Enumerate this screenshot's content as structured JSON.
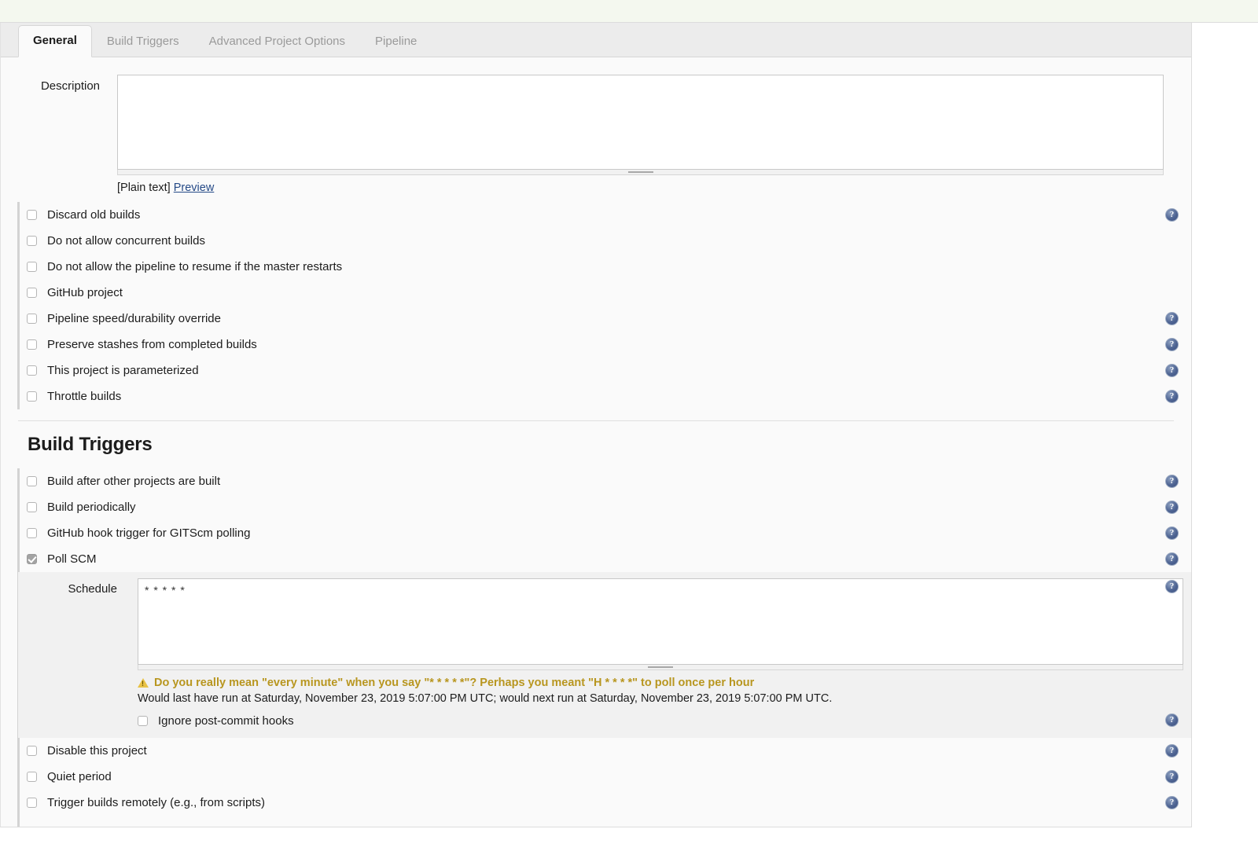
{
  "tabs": [
    {
      "label": "General",
      "active": true
    },
    {
      "label": "Build Triggers",
      "active": false
    },
    {
      "label": "Advanced Project Options",
      "active": false
    },
    {
      "label": "Pipeline",
      "active": false
    }
  ],
  "description": {
    "label": "Description",
    "value": "",
    "markup_note": "[Plain text]",
    "preview_link": "Preview"
  },
  "general_options": [
    {
      "label": "Discard old builds",
      "checked": false,
      "help": true
    },
    {
      "label": "Do not allow concurrent builds",
      "checked": false,
      "help": false
    },
    {
      "label": "Do not allow the pipeline to resume if the master restarts",
      "checked": false,
      "help": false
    },
    {
      "label": "GitHub project",
      "checked": false,
      "help": false
    },
    {
      "label": "Pipeline speed/durability override",
      "checked": false,
      "help": true
    },
    {
      "label": "Preserve stashes from completed builds",
      "checked": false,
      "help": true
    },
    {
      "label": "This project is parameterized",
      "checked": false,
      "help": true
    },
    {
      "label": "Throttle builds",
      "checked": false,
      "help": true
    }
  ],
  "build_triggers": {
    "title": "Build Triggers",
    "options": [
      {
        "label": "Build after other projects are built",
        "checked": false,
        "help": true
      },
      {
        "label": "Build periodically",
        "checked": false,
        "help": true
      },
      {
        "label": "GitHub hook trigger for GITScm polling",
        "checked": false,
        "help": true
      },
      {
        "label": "Poll SCM",
        "checked": true,
        "help": true
      }
    ],
    "schedule": {
      "label": "Schedule",
      "value": "* * * * *",
      "warning": "Do you really mean \"every minute\" when you say \"* * * * *\"? Perhaps you meant \"H * * * *\" to poll once per hour",
      "next_run": "Would last have run at Saturday, November 23, 2019 5:07:00 PM UTC; would next run at Saturday, November 23, 2019 5:07:00 PM UTC.",
      "ignore_hooks_label": "Ignore post-commit hooks",
      "ignore_hooks_checked": false,
      "help": true
    },
    "bottom_options": [
      {
        "label": "Disable this project",
        "checked": false,
        "help": true
      },
      {
        "label": "Quiet period",
        "checked": false,
        "help": true
      },
      {
        "label": "Trigger builds remotely (e.g., from scripts)",
        "checked": false,
        "help": true
      }
    ]
  },
  "colors": {
    "warning_text": "#b8961f",
    "link": "#254a87",
    "panel_bg": "#fafafa",
    "shaded_bg": "#f1f1f1",
    "top_strip": "#f4f8ef"
  },
  "icons": {
    "help": "?",
    "warning": "warning-triangle-icon"
  }
}
